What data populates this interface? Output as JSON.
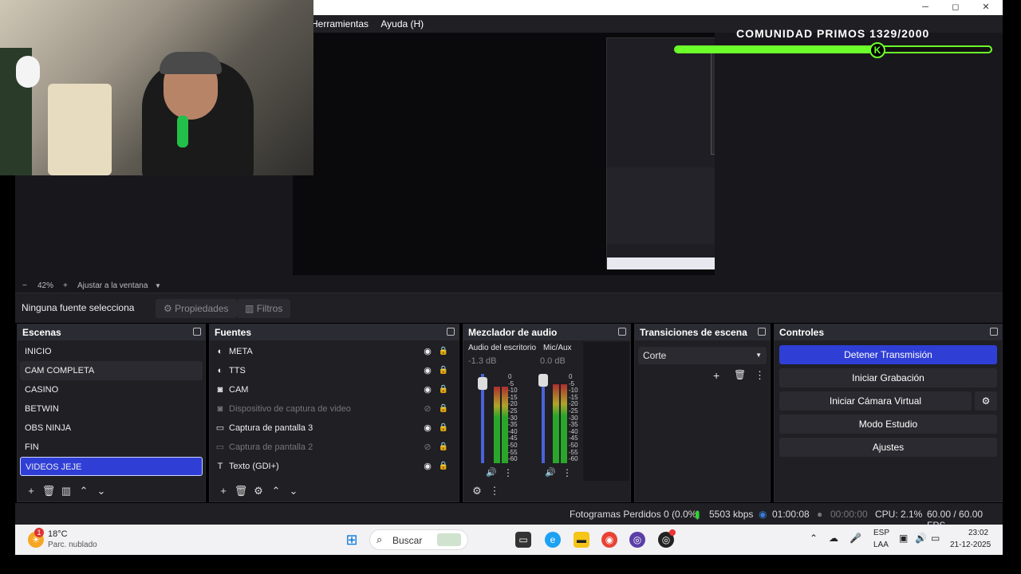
{
  "window": {
    "minimize": "─",
    "maximize": "◻",
    "close": "✕"
  },
  "menu": {
    "items": [
      "Herramientas",
      "Ayuda (H)"
    ]
  },
  "overlay": {
    "community": "COMUNIDAD PRIMOS 1329/2000",
    "progress": 0.66,
    "knob_label": "K"
  },
  "zoom": {
    "minus": "−",
    "value": "42%",
    "plus": "+",
    "fit": "Ajustar a la ventana"
  },
  "source_toolbar": {
    "none_selected": "Ninguna fuente selecciona",
    "properties": "Propiedades",
    "filters": "Filtros"
  },
  "scenes": {
    "title": "Escenas",
    "items": [
      "INICIO",
      "CAM COMPLETA",
      "CASINO",
      "BETWIN",
      "OBS NINJA",
      "FIN",
      "VIDEOS JEJE"
    ],
    "selected": 6,
    "hovered": 1
  },
  "sources": {
    "title": "Fuentes",
    "items": [
      {
        "name": "META",
        "icon": "globe-icon",
        "visible": true
      },
      {
        "name": "TTS",
        "icon": "globe-icon",
        "visible": true
      },
      {
        "name": "CAM",
        "icon": "camera-icon",
        "visible": true
      },
      {
        "name": "Dispositivo de captura de video",
        "icon": "camera-icon",
        "visible": false
      },
      {
        "name": "Captura de pantalla 3",
        "icon": "monitor-icon",
        "visible": true
      },
      {
        "name": "Captura de pantalla 2",
        "icon": "monitor-icon",
        "visible": false
      },
      {
        "name": "Texto (GDI+)",
        "icon": "text-icon",
        "visible": true
      }
    ]
  },
  "mixer": {
    "title": "Mezclador de audio",
    "channels": [
      {
        "name": "Audio del escritorio",
        "db": "-1.3 dB",
        "level": 0.86
      },
      {
        "name": "Mic/Aux",
        "db": "0.0 dB",
        "level": 0.88
      }
    ],
    "scale": [
      "0",
      "-5",
      "-10",
      "-15",
      "-20",
      "-25",
      "-30",
      "-35",
      "-40",
      "-45",
      "-50",
      "-55",
      "-60"
    ]
  },
  "transitions": {
    "title": "Transiciones de escena",
    "selected": "Corte"
  },
  "controls": {
    "title": "Controles",
    "stop_stream": "Detener Transmisión",
    "start_recording": "Iniciar Grabación",
    "virtual_cam": "Iniciar Cámara Virtual",
    "studio_mode": "Modo Estudio",
    "settings": "Ajustes",
    "accent": "#2f3fd6"
  },
  "status": {
    "dropped": "Fotogramas Perdidos 0 (0.0%)",
    "bitrate": "5503 kbps",
    "stream_time": "01:00:08",
    "rec_time": "00:00:00",
    "cpu": "CPU: 2.1%",
    "fps": "60.00 / 60.00 FPS"
  },
  "taskbar": {
    "weather_temp": "18°C",
    "weather_desc": "Parc. nublado",
    "weather_badge": "1",
    "search": "Buscar",
    "lang1": "ESP",
    "lang2": "LAA",
    "time": "23:02",
    "date": "21-12-2025"
  }
}
